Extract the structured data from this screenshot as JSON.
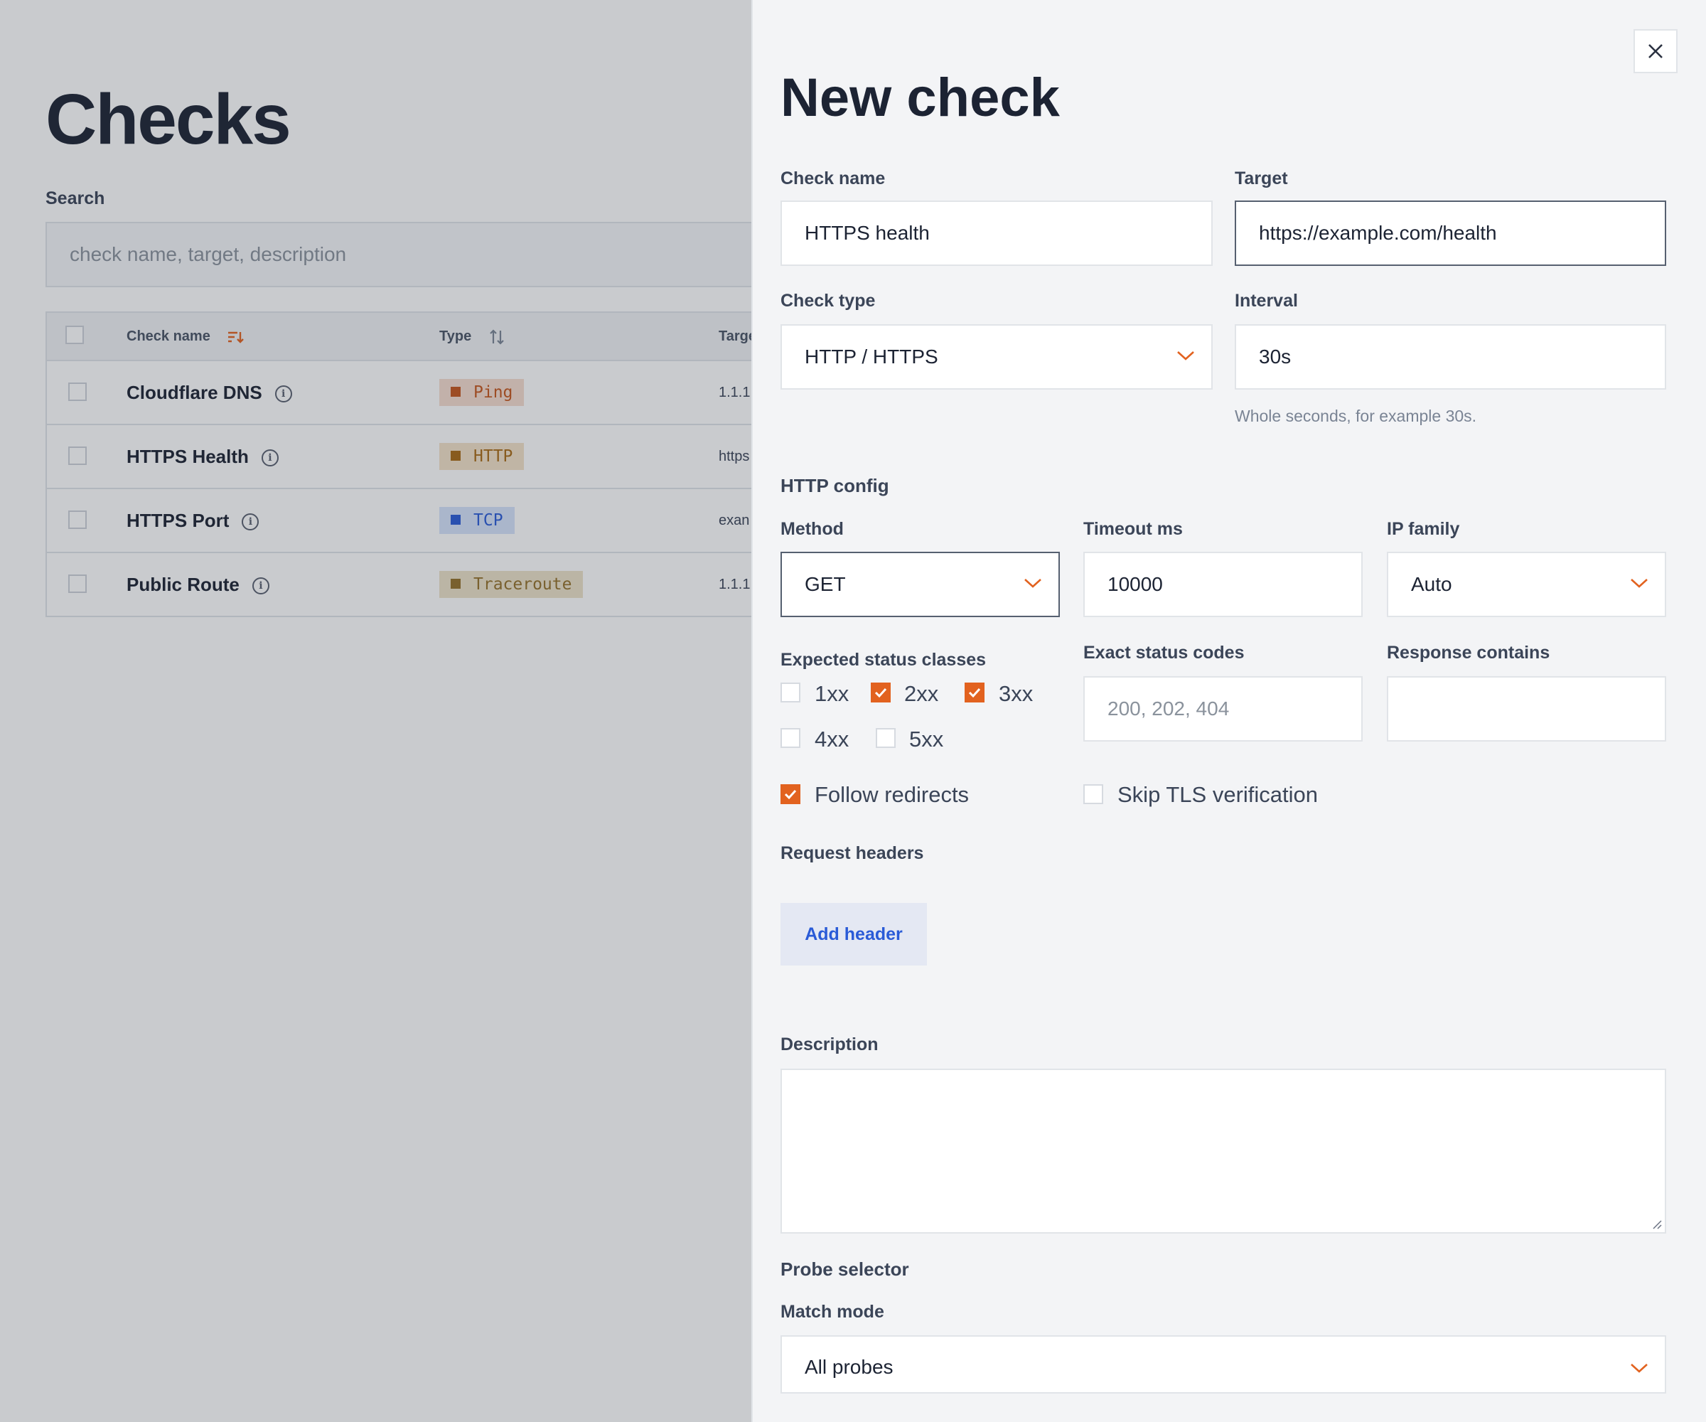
{
  "page": {
    "title": "Checks",
    "search": {
      "label": "Search",
      "placeholder": "check name, target, description"
    },
    "table": {
      "columns": {
        "name": "Check name",
        "type": "Type",
        "target": "Targe"
      },
      "rows": [
        {
          "name": "Cloudflare DNS",
          "type": "Ping",
          "target": "1.1.1.1"
        },
        {
          "name": "HTTPS Health",
          "type": "HTTP",
          "target": "https"
        },
        {
          "name": "HTTPS Port",
          "type": "TCP",
          "target": "exan"
        },
        {
          "name": "Public Route",
          "type": "Traceroute",
          "target": "1.1.1.1"
        }
      ]
    }
  },
  "drawer": {
    "title": "New check",
    "check_name": {
      "label": "Check name",
      "value": "HTTPS health"
    },
    "target": {
      "label": "Target",
      "value": "https://example.com/health"
    },
    "check_type": {
      "label": "Check type",
      "value": "HTTP / HTTPS"
    },
    "interval": {
      "label": "Interval",
      "value": "30s",
      "hint": "Whole seconds, for example 30s."
    },
    "http_config": {
      "section": "HTTP config",
      "method": {
        "label": "Method",
        "value": "GET"
      },
      "timeout": {
        "label": "Timeout ms",
        "value": "10000"
      },
      "ip_family": {
        "label": "IP family",
        "value": "Auto"
      },
      "status_classes": {
        "label": "Expected status classes",
        "options": [
          {
            "label": "1xx",
            "checked": false
          },
          {
            "label": "2xx",
            "checked": true
          },
          {
            "label": "3xx",
            "checked": true
          },
          {
            "label": "4xx",
            "checked": false
          },
          {
            "label": "5xx",
            "checked": false
          }
        ]
      },
      "exact_codes": {
        "label": "Exact status codes",
        "placeholder": "200, 202, 404"
      },
      "response_contains": {
        "label": "Response contains",
        "value": ""
      },
      "follow_redirects": {
        "label": "Follow redirects",
        "checked": true
      },
      "skip_tls": {
        "label": "Skip TLS verification",
        "checked": false
      },
      "request_headers": {
        "label": "Request headers",
        "add_button": "Add header"
      }
    },
    "description": {
      "label": "Description",
      "value": ""
    },
    "probe_selector": {
      "section": "Probe selector",
      "match_mode": {
        "label": "Match mode",
        "value": "All probes"
      }
    }
  },
  "colors": {
    "accent": "#e2621f",
    "link": "#2a5bd7",
    "text": "#1c2333"
  }
}
